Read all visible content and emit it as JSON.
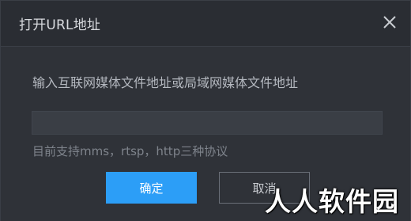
{
  "dialog": {
    "title": "打开URL地址",
    "close_icon": "close-icon"
  },
  "form": {
    "prompt": "输入互联网媒体文件地址或局域网媒体文件地址",
    "url_value": "",
    "url_placeholder": "",
    "hint": "目前支持mms，rtsp，http三种协议"
  },
  "buttons": {
    "ok_label": "确定",
    "cancel_label": "取消"
  },
  "watermark": {
    "text": "人人软件园"
  },
  "colors": {
    "accent": "#2c9ef7",
    "background": "#2f3238",
    "titlebar": "#2a2d33"
  }
}
